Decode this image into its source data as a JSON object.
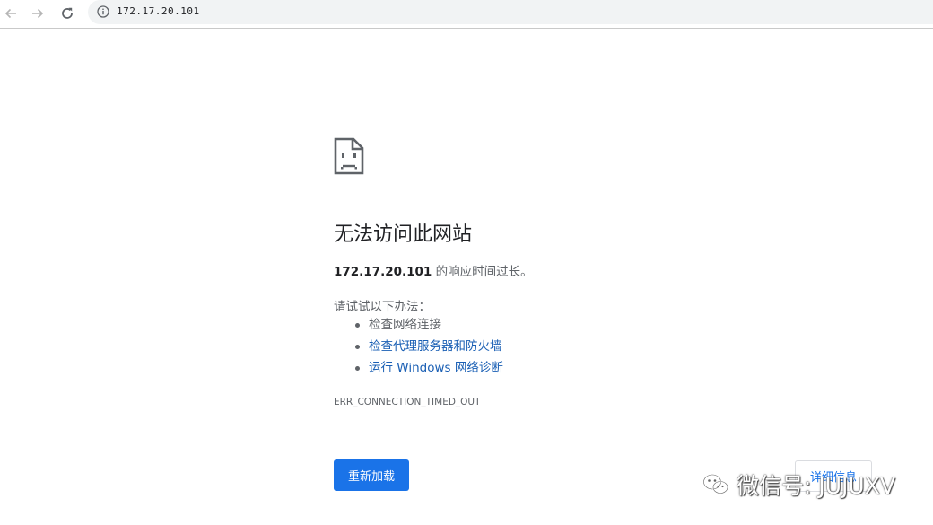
{
  "browser": {
    "url": "172.17.20.101",
    "icons": {
      "back": "back-arrow-icon",
      "forward": "forward-arrow-icon",
      "reload": "reload-icon",
      "info": "info-icon"
    }
  },
  "error_page": {
    "icon": "sad-page-icon",
    "title": "无法访问此网站",
    "summary_host": "172.17.20.101",
    "summary_text": " 的响应时间过长。",
    "suggestions_heading": "请试试以下办法：",
    "suggestions": [
      "检查网络连接",
      "检查代理服务器和防火墙",
      "运行 Windows 网络诊断"
    ],
    "error_code": "ERR_CONNECTION_TIMED_OUT",
    "reload_button": "重新加载",
    "details_button": "详细信息"
  },
  "watermark": {
    "text": "微信号: JUJUXV"
  },
  "colors": {
    "primary_blue": "#1a73e8",
    "link_blue": "#1a5fb4",
    "text_gray": "#5f6368"
  }
}
